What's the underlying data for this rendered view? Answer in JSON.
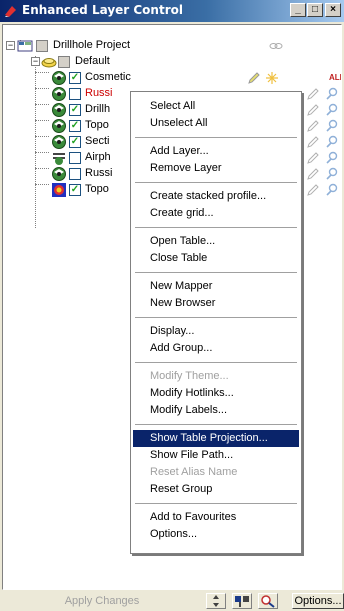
{
  "window": {
    "title": "Enhanced Layer Control",
    "minimize": "_",
    "maximize": "□",
    "close": "×"
  },
  "tree": {
    "project": {
      "label": "Drillhole Project",
      "expander": "−"
    },
    "group": {
      "label": "Default",
      "expander": "−"
    },
    "layers": [
      {
        "label": "Cosmetic",
        "checked": true,
        "color": "#000000"
      },
      {
        "label": "Russi",
        "checked": false,
        "color": "#cc0000"
      },
      {
        "label": "Drillh",
        "checked": true,
        "color": "#000000"
      },
      {
        "label": "Topo",
        "checked": true,
        "color": "#000000"
      },
      {
        "label": "Secti",
        "checked": true,
        "color": "#000000"
      },
      {
        "label": "Airph",
        "checked": false,
        "color": "#000000"
      },
      {
        "label": "Russi",
        "checked": false,
        "color": "#000000"
      },
      {
        "label": "Topo",
        "checked": true,
        "color": "#000000"
      }
    ],
    "cosmetic_badge": "ALL"
  },
  "context_menu": {
    "items": [
      {
        "label": "Select All",
        "state": "normal"
      },
      {
        "label": "Unselect All",
        "state": "normal"
      },
      {
        "label": "Add Layer...",
        "state": "normal"
      },
      {
        "label": "Remove Layer",
        "state": "normal"
      },
      {
        "label": "Create stacked profile...",
        "state": "normal"
      },
      {
        "label": "Create grid...",
        "state": "normal"
      },
      {
        "label": "Open Table...",
        "state": "normal"
      },
      {
        "label": "Close Table",
        "state": "normal"
      },
      {
        "label": "New Mapper",
        "state": "normal"
      },
      {
        "label": "New Browser",
        "state": "normal"
      },
      {
        "label": "Display...",
        "state": "normal"
      },
      {
        "label": "Add Group...",
        "state": "normal"
      },
      {
        "label": "Modify Theme...",
        "state": "disabled"
      },
      {
        "label": "Modify Hotlinks...",
        "state": "normal"
      },
      {
        "label": "Modify Labels...",
        "state": "normal"
      },
      {
        "label": "Show Table Projection...",
        "state": "selected"
      },
      {
        "label": "Show File Path...",
        "state": "normal"
      },
      {
        "label": "Reset Alias Name",
        "state": "disabled"
      },
      {
        "label": "Reset Group",
        "state": "normal"
      },
      {
        "label": "Add to Favourites",
        "state": "normal"
      },
      {
        "label": "Options...",
        "state": "normal"
      }
    ]
  },
  "statusbar": {
    "apply_label": "Apply Changes",
    "options_label": "Options..."
  },
  "colors": {
    "title_start": "#0a246a",
    "selection": "#0a246a",
    "disabled": "#a0a0a0"
  }
}
